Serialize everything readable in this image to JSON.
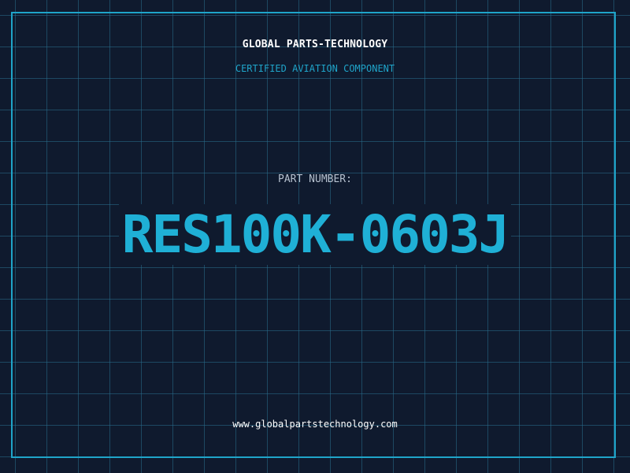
{
  "header": {
    "company": "GLOBAL PARTS-TECHNOLOGY",
    "subtitle": "CERTIFIED AVIATION COMPONENT"
  },
  "part": {
    "label": "PART NUMBER:",
    "number": "RES100K-0603J"
  },
  "footer": {
    "website": "www.globalpartstechnology.com"
  },
  "colors": {
    "background": "#0f1a2e",
    "accent": "#1fa4c9",
    "grid": "#286e8c",
    "text": "#ffffff"
  }
}
